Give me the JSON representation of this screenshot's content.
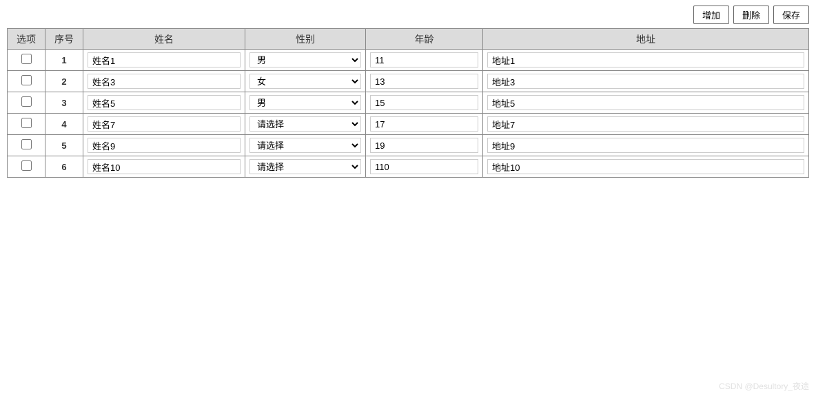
{
  "toolbar": {
    "add": "增加",
    "delete": "删除",
    "save": "保存"
  },
  "table": {
    "headers": {
      "check": "选项",
      "seq": "序号",
      "name": "姓名",
      "sex": "性别",
      "age": "年龄",
      "addr": "地址"
    },
    "sex_options": {
      "placeholder": "请选择",
      "male": "男",
      "female": "女"
    },
    "rows": [
      {
        "seq": "1",
        "name": "姓名1",
        "sex": "男",
        "age": "11",
        "addr": "地址1"
      },
      {
        "seq": "2",
        "name": "姓名3",
        "sex": "女",
        "age": "13",
        "addr": "地址3"
      },
      {
        "seq": "3",
        "name": "姓名5",
        "sex": "男",
        "age": "15",
        "addr": "地址5"
      },
      {
        "seq": "4",
        "name": "姓名7",
        "sex": "请选择",
        "age": "17",
        "addr": "地址7"
      },
      {
        "seq": "5",
        "name": "姓名9",
        "sex": "请选择",
        "age": "19",
        "addr": "地址9"
      },
      {
        "seq": "6",
        "name": "姓名10",
        "sex": "请选择",
        "age": "110",
        "addr": "地址10"
      }
    ]
  },
  "watermark": "CSDN @Desultory_夜途"
}
